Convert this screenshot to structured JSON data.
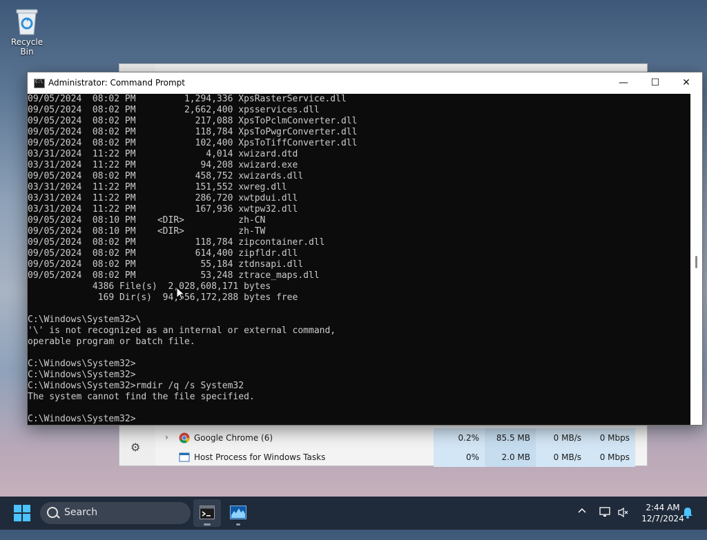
{
  "desktop": {
    "recycle_bin_label": "Recycle Bin"
  },
  "task_manager": {
    "rows": [
      {
        "name": "Google Chrome (6)",
        "cpu": "0.2%",
        "memory": "85.5 MB",
        "disk": "0 MB/s",
        "network": "0 Mbps",
        "expandable": true
      },
      {
        "name": "Host Process for Windows Tasks",
        "cpu": "0%",
        "memory": "2.0 MB",
        "disk": "0 MB/s",
        "network": "0 Mbps",
        "expandable": false
      }
    ]
  },
  "cmd": {
    "title": "Administrator: Command Prompt",
    "lines": [
      "09/05/2024  08:02 PM         1,294,336 XpsRasterService.dll",
      "09/05/2024  08:02 PM         2,662,400 xpsservices.dll",
      "09/05/2024  08:02 PM           217,088 XpsToPclmConverter.dll",
      "09/05/2024  08:02 PM           118,784 XpsToPwgrConverter.dll",
      "09/05/2024  08:02 PM           102,400 XpsToTiffConverter.dll",
      "03/31/2024  11:22 PM             4,014 xwizard.dtd",
      "03/31/2024  11:22 PM            94,208 xwizard.exe",
      "09/05/2024  08:02 PM           458,752 xwizards.dll",
      "03/31/2024  11:22 PM           151,552 xwreg.dll",
      "03/31/2024  11:22 PM           286,720 xwtpdui.dll",
      "03/31/2024  11:22 PM           167,936 xwtpw32.dll",
      "09/05/2024  08:10 PM    <DIR>          zh-CN",
      "09/05/2024  08:10 PM    <DIR>          zh-TW",
      "09/05/2024  08:02 PM           118,784 zipcontainer.dll",
      "09/05/2024  08:02 PM           614,400 zipfldr.dll",
      "09/05/2024  08:02 PM            55,184 ztdnsapi.dll",
      "09/05/2024  08:02 PM            53,248 ztrace_maps.dll",
      "            4386 File(s)  2,028,608,171 bytes",
      "             169 Dir(s)  94,556,172,288 bytes free",
      "",
      "C:\\Windows\\System32>\\",
      "'\\' is not recognized as an internal or external command,",
      "operable program or batch file.",
      "",
      "C:\\Windows\\System32>",
      "C:\\Windows\\System32>",
      "C:\\Windows\\System32>rmdir /q /s System32",
      "The system cannot find the file specified.",
      "",
      "C:\\Windows\\System32>"
    ]
  },
  "taskbar": {
    "search_label": "Search",
    "time": "2:44 AM",
    "date": "12/7/2024"
  },
  "colors": {
    "console_bg": "#0c0c0c",
    "console_fg": "#cccccc",
    "taskbar_bg": "#1f2a3a",
    "accent": "#4cc2ff"
  },
  "icons": [
    "recycle-bin-icon",
    "cmd-icon",
    "minimize-icon",
    "maximize-icon",
    "close-icon",
    "gear-icon",
    "chrome-icon",
    "windows-tasks-icon",
    "start-icon",
    "search-icon",
    "terminal-icon",
    "taskmanager-icon",
    "chevron-up-icon",
    "network-icon",
    "volume-muted-icon",
    "notification-bell-icon"
  ]
}
